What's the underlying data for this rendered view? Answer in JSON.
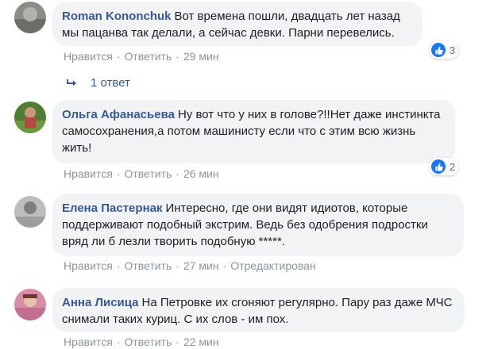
{
  "comments": [
    {
      "author": "Roman Kononchuk",
      "text": "Вот времена пошли, двадцать лет назад мы пацанва так делали, а сейчас девки. Парни перевелись.",
      "like_label": "Нравится",
      "reply_label": "Ответить",
      "time": "29 мин",
      "reaction_count": "3"
    },
    {
      "author": "Ольга Афанасьева",
      "text": "Ну вот что у них в голове?!!Нет даже инстинкта самосохранения,а потом машинисту если что с этим всю жизнь жить!",
      "like_label": "Нравится",
      "reply_label": "Ответить",
      "time": "26 мин",
      "reaction_count": "2"
    },
    {
      "author": "Елена Пастернак",
      "text": "Интересно, где они видят идиотов, которые поддерживают подобный экстрим. Ведь без одобрения подростки вряд ли б лезли творить подобную *****.",
      "like_label": "Нравится",
      "reply_label": "Ответить",
      "time": "27 мин",
      "edited": "Отредактирован"
    },
    {
      "author": "Анна Лисица",
      "text": "На Петровке их сгоняют регулярно. Пару раз даже МЧС снимали таких куриц. С их слов - им пох.",
      "like_label": "Нравится",
      "reply_label": "Ответить",
      "time": "22 мин"
    }
  ],
  "replies_link": "1 ответ",
  "colors": {
    "bubble": "#f2f3f5",
    "author": "#385898",
    "meta": "#8d949e",
    "like_badge": "#1877f2"
  },
  "icons": [
    "reply-arrow-icon",
    "thumbs-up-icon"
  ]
}
